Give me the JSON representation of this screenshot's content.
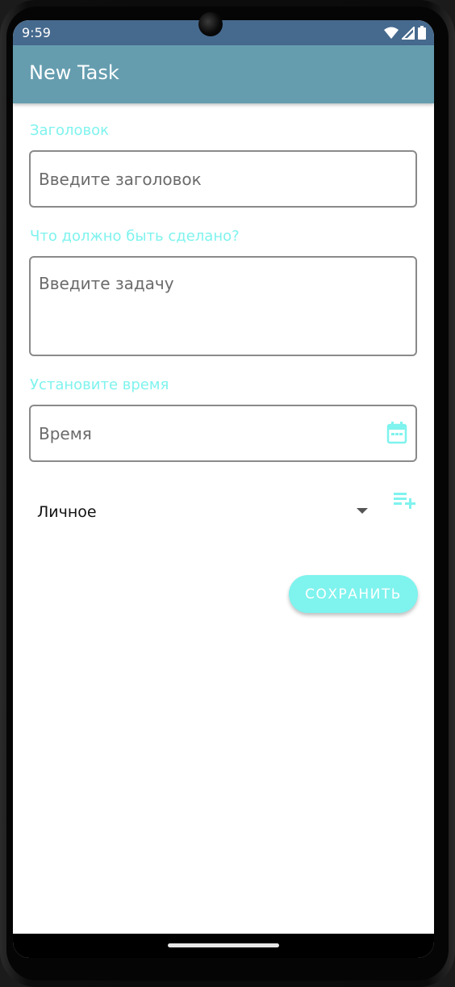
{
  "status_bar": {
    "time": "9:59"
  },
  "app_bar": {
    "title": "New Task"
  },
  "form": {
    "title_label": "Заголовок",
    "title_placeholder": "Введите заголовок",
    "task_label": "Что должно быть сделано?",
    "task_placeholder": "Введите задачу",
    "time_label": "Установите время",
    "time_placeholder": "Время",
    "category_selected": "Личное",
    "save_label": "СОХРАНИТЬ"
  },
  "colors": {
    "accent": "#7ff3ee",
    "app_bar": "#659daf",
    "status_bar": "#466a8e"
  },
  "icons": [
    "wifi-icon",
    "signal-icon",
    "battery-icon",
    "calendar-icon",
    "dropdown-arrow-icon",
    "playlist-add-icon"
  ]
}
